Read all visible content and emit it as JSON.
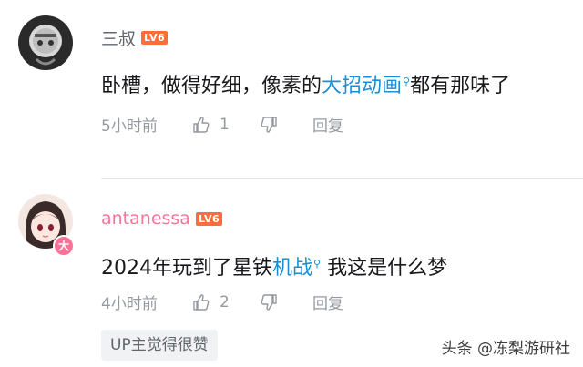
{
  "comments": [
    {
      "username": "三叔",
      "level": "LV6",
      "content_before": "卧槽，做得好细，像素的",
      "content_link": "大招动画",
      "content_after": "都有那味了",
      "time": "5小时前",
      "likes": "1",
      "reply_label": "回复"
    },
    {
      "username": "antanessa",
      "level": "LV6",
      "content_before": "2024年玩到了星铁",
      "content_link": "机战",
      "content_after": "我这是什么梦",
      "time": "4小时前",
      "likes": "2",
      "reply_label": "回复"
    }
  ],
  "up_badge": "UP主觉得很赞",
  "watermark": "头条 @冻梨游研社",
  "colors": {
    "accent_link": "#1a8fd6",
    "username_vip": "#fb7299",
    "level_badge": "#ff6d3a"
  }
}
